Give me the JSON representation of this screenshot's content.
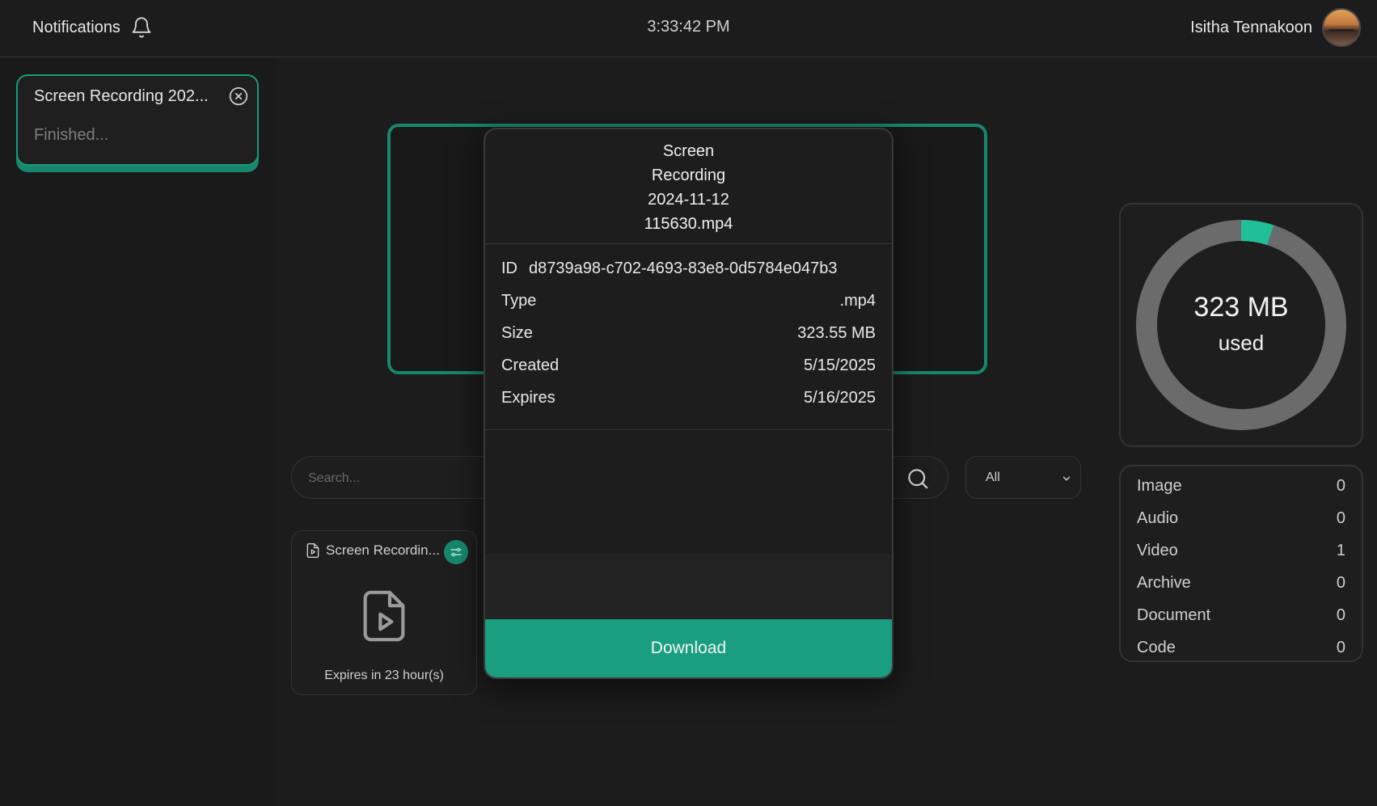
{
  "topbar": {
    "notifications_label": "Notifications",
    "clock": "3:33:42 PM",
    "user_name": "Isitha Tennakoon"
  },
  "toast": {
    "title": "Screen Recording 202...",
    "status": "Finished..."
  },
  "storage": {
    "used_value": "323 MB",
    "used_label": "used",
    "used_fraction": 0.05,
    "accent_color": "#1fbf98",
    "track_color": "#6b6b6b"
  },
  "categories": [
    {
      "label": "Image",
      "count": "0"
    },
    {
      "label": "Audio",
      "count": "0"
    },
    {
      "label": "Video",
      "count": "1"
    },
    {
      "label": "Archive",
      "count": "0"
    },
    {
      "label": "Document",
      "count": "0"
    },
    {
      "label": "Code",
      "count": "0"
    }
  ],
  "search": {
    "placeholder": "Search..."
  },
  "filter": {
    "selected": "All"
  },
  "file_card": {
    "name": "Screen Recordin...",
    "expires": "Expires in 23 hour(s)"
  },
  "modal": {
    "title_lines": [
      "Screen",
      "Recording",
      "2024-11-12",
      "115630.mp4"
    ],
    "id_label": "ID",
    "id_value": "d8739a98-c702-4693-83e8-0d5784e047b3",
    "rows": [
      {
        "label": "Type",
        "value": ".mp4"
      },
      {
        "label": "Size",
        "value": "323.55 MB"
      },
      {
        "label": "Created",
        "value": "5/15/2025"
      },
      {
        "label": "Expires",
        "value": "5/16/2025"
      }
    ],
    "download_label": "Download"
  },
  "colors": {
    "accent": "#199e80",
    "background": "#1c1c1c"
  }
}
